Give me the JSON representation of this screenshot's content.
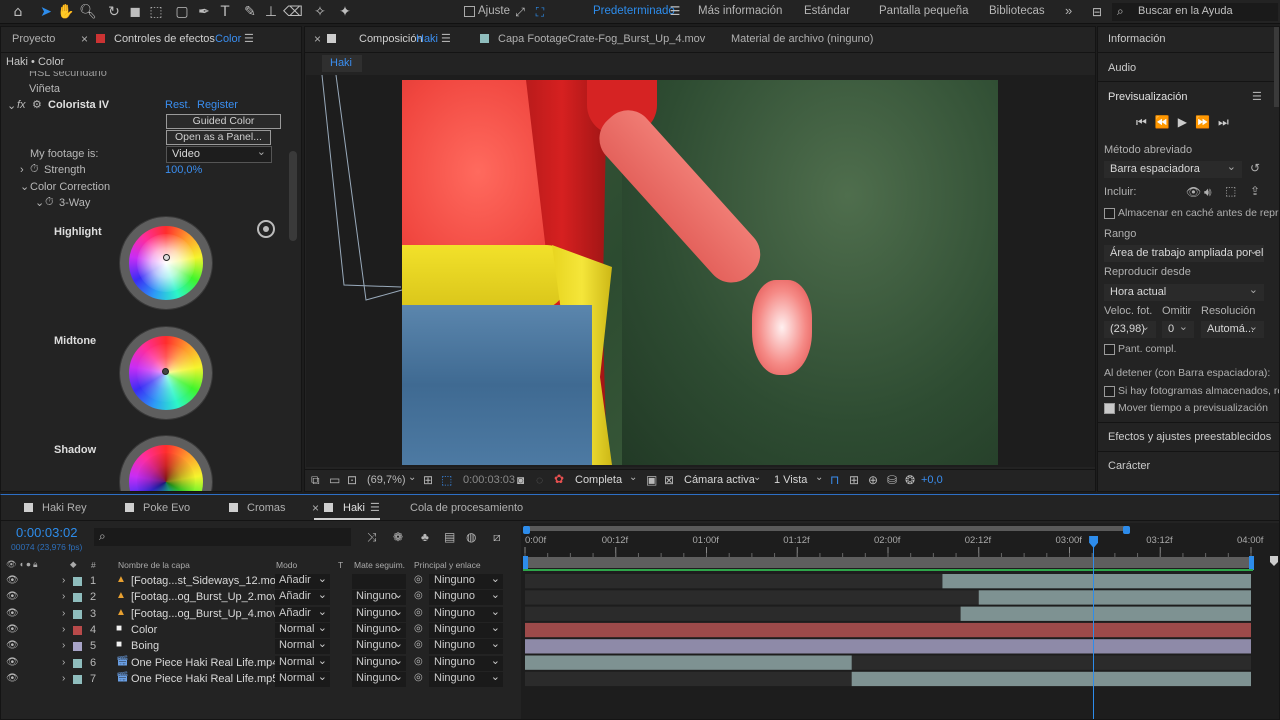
{
  "toolbar": {
    "snap_label": "Ajuste",
    "workspaces": [
      "Predeterminado",
      "Más información",
      "Estándar",
      "Pantalla pequeña",
      "Bibliotecas"
    ],
    "active_workspace": "Predeterminado",
    "search_placeholder": "Buscar en la Ayuda",
    "more_glyph": "»"
  },
  "left_panel": {
    "tab_project": "Proyecto",
    "tab_effects": "Controles de efectos",
    "tab_effects_target": "Color",
    "breadcrumb": "Haki • Color",
    "rows": {
      "hsl": "HSL secundario",
      "vignette": "Viñeta",
      "fx_label": "fx",
      "effect_name": "Colorista IV",
      "reset": "Rest.",
      "register": "Register",
      "guided_btn": "Guided Color Correction...",
      "panel_btn": "Open as a Panel...",
      "footage_label": "My footage is:",
      "footage_value": "Video",
      "strength_label": "Strength",
      "strength_value": "100,0%",
      "color_correction": "Color Correction",
      "three_way": "3-Way",
      "highlight": "Highlight",
      "midtone": "Midtone",
      "shadow": "Shadow"
    }
  },
  "viewer": {
    "tab_comp": "Composición",
    "tab_comp_name": "Haki",
    "tab_layer": "Capa  FootageCrate-Fog_Burst_Up_4.mov",
    "tab_footage": "Material de archivo  (ninguno)",
    "sub_tab": "Haki",
    "zoom": "(69,7%)",
    "timecode": "0:00:03:03",
    "quality": "Completa",
    "camera": "Cámara activa",
    "views": "1 Vista",
    "exposure": "+0,0"
  },
  "right_panel": {
    "info": "Información",
    "audio": "Audio",
    "preview": "Previsualización",
    "shortcut_label": "Método abreviado",
    "shortcut_value": "Barra espaciadora",
    "include_label": "Incluir:",
    "cache_label": "Almacenar en caché antes de reproducir",
    "range_label": "Rango",
    "range_value": "Área de trabajo ampliada por el ...",
    "play_from_label": "Reproducir desde",
    "play_from_value": "Hora actual",
    "fps_label": "Veloc. fot.",
    "skip_label": "Omitir",
    "res_label": "Resolución",
    "fps_value": "(23,98)",
    "skip_value": "0",
    "res_value": "Automá...",
    "fullscreen_label": "Pant. compl.",
    "on_stop_label": "Al detener (con Barra espaciadora):",
    "cached_frames_label": "Si hay fotogramas almacenados, reproducir",
    "move_time_label": "Mover tiempo a previsualización",
    "effects_presets": "Efectos y ajustes preestablecidos",
    "character": "Carácter",
    "colors": {
      "accent": "#2d8ceb"
    }
  },
  "timeline": {
    "tabs": [
      "Haki Rey",
      "Poke Evo",
      "Cromas",
      "Haki",
      "Cola de procesamiento"
    ],
    "active_tab": "Haki",
    "timecode": "0:00:03:02",
    "frame_info": "00074 (23,976 fps)",
    "search_placeholder": "",
    "col_number": "#",
    "col_name": "Nombre de la capa",
    "col_mode": "Modo",
    "col_t": "T",
    "col_matte": "Mate seguim.",
    "col_parent": "Principal y enlace",
    "ruler": [
      "0:00f",
      "00:12f",
      "01:00f",
      "01:12f",
      "02:00f",
      "02:12f",
      "03:00f",
      "03:12f",
      "04:00f"
    ],
    "layers": [
      {
        "num": "1",
        "name": "[Footag...st_Sideways_12.mov]",
        "mode": "Añadir",
        "matte": "",
        "parent": "Ninguno",
        "color": "#8fbdbd",
        "type": "footage",
        "bar_start": 2.3,
        "bar_end": 4.0,
        "bar_color": "#7e9292"
      },
      {
        "num": "2",
        "name": "[Footag...og_Burst_Up_2.mov]",
        "mode": "Añadir",
        "matte": "Ninguno",
        "parent": "Ninguno",
        "color": "#8fbdbd",
        "type": "footage",
        "bar_start": 2.5,
        "bar_end": 4.0,
        "bar_color": "#7e9292"
      },
      {
        "num": "3",
        "name": "[Footag...og_Burst_Up_4.mov]",
        "mode": "Añadir",
        "matte": "Ninguno",
        "parent": "Ninguno",
        "color": "#8fbdbd",
        "type": "footage",
        "bar_start": 2.4,
        "bar_end": 4.0,
        "bar_color": "#7e9292"
      },
      {
        "num": "4",
        "name": "Color",
        "mode": "Normal",
        "matte": "Ninguno",
        "parent": "Ninguno",
        "color": "#b84a4a",
        "type": "solid",
        "bar_start": 0.0,
        "bar_end": 4.0,
        "bar_color": "#9d4a4a"
      },
      {
        "num": "5",
        "name": "Boing",
        "mode": "Normal",
        "matte": "Ninguno",
        "parent": "Ninguno",
        "color": "#a8a4c8",
        "type": "solid",
        "bar_start": 0.0,
        "bar_end": 4.0,
        "bar_color": "#8e8aa8"
      },
      {
        "num": "6",
        "name": "One Piece Haki Real Life.mp4",
        "mode": "Normal",
        "matte": "Ninguno",
        "parent": "Ninguno",
        "color": "#8fbdbd",
        "type": "video",
        "bar_start": 0.0,
        "bar_end": 1.8,
        "bar_color": "#7e9292"
      },
      {
        "num": "7",
        "name": "One Piece Haki Real Life.mp5",
        "mode": "Normal",
        "matte": "Ninguno",
        "parent": "Ninguno",
        "color": "#8fbdbd",
        "type": "video",
        "bar_start": 1.8,
        "bar_end": 4.0,
        "bar_color": "#7e9292"
      }
    ],
    "playhead_time": 3.13,
    "duration": 4.0
  }
}
